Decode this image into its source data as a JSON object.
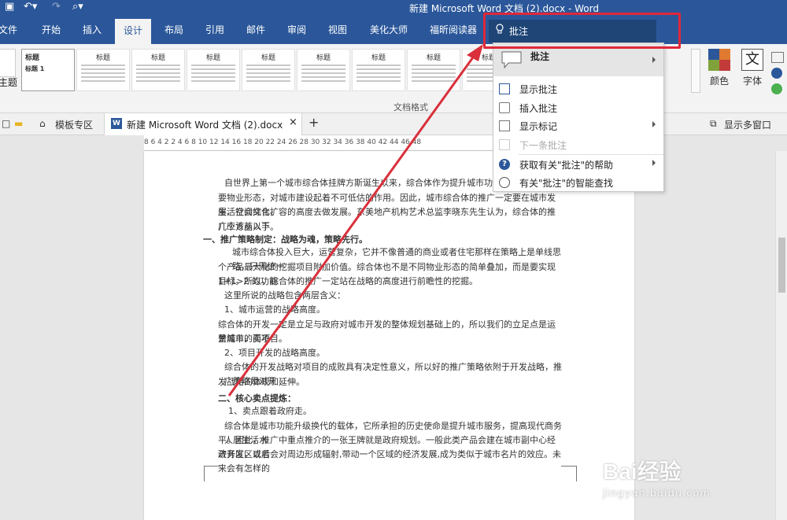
{
  "titlebar": {
    "document_title": "新建 Microsoft Word 文档 (2).docx  -  Word"
  },
  "tabs": [
    {
      "label": "文件"
    },
    {
      "label": "开始"
    },
    {
      "label": "插入"
    },
    {
      "label": "设计",
      "active": true
    },
    {
      "label": "布局"
    },
    {
      "label": "引用"
    },
    {
      "label": "邮件"
    },
    {
      "label": "审阅"
    },
    {
      "label": "视图"
    },
    {
      "label": "美化大师"
    },
    {
      "label": "福昕阅读器"
    }
  ],
  "tell_me": {
    "value": "批注",
    "icon": "lightbulb-icon"
  },
  "ribbon": {
    "left_label": "主题",
    "style_thumbs": [
      {
        "heading": "标题"
      },
      {
        "heading": "标题"
      },
      {
        "heading": "标题"
      },
      {
        "heading": "标题"
      },
      {
        "heading": "标题"
      },
      {
        "heading": "标题"
      },
      {
        "heading": "标题"
      },
      {
        "heading": "标题"
      },
      {
        "heading": "标题"
      }
    ],
    "first_thumb_subtitle": "标题 1",
    "group_label": "文档格式",
    "colors_label": "颜色",
    "fonts_label": "字体"
  },
  "doc_tabs": {
    "template_zone": "模板专区",
    "active_doc": "新建 Microsoft Word 文档 (2).docx",
    "show_multi_window": "显示多窗口"
  },
  "ruler": {
    "ticks": "8   6   4   2       2   4   6   8   10  12  14  16  18  20  22  24  26  28  30  32  34  36  38  40  42  44  46  48"
  },
  "menu": {
    "header": "批注",
    "items": [
      {
        "label": "显示批注",
        "icon": "show-comments-icon",
        "submenu": false,
        "disabled": false
      },
      {
        "label": "插入批注",
        "icon": "insert-comment-icon",
        "submenu": false,
        "disabled": false
      },
      {
        "label": "显示标记",
        "icon": "show-markup-icon",
        "submenu": true,
        "disabled": false
      },
      {
        "label": "下一条批注",
        "icon": "next-comment-icon",
        "submenu": false,
        "disabled": true
      },
      {
        "label": "获取有关\"批注\"的帮助",
        "icon": "help-icon",
        "submenu": true,
        "disabled": false
      },
      {
        "label": "有关\"批注\"的智能查找",
        "icon": "smart-lookup-icon",
        "submenu": false,
        "disabled": false
      }
    ]
  },
  "document": {
    "lines": [
      "自世界上第一个城市综合体挂牌方斯诞生以来，综合体作为提升城市功能、优化城市",
      "要物业形态，对城市建设起着不可低估的作用。因此，城市综合体的推广一定要在城市发展、社会文化、",
      "生活空间综合扩容的高度去做发展。东美地产机构艺术总监李晓东先生认为，综合体的推广应该从以下",
      "几个方面入手。",
      "一、推广策略制定：战略为魂，策略先行。",
      "城市综合体投入巨大，运营复杂，它并不像普通的商业或者住宅那样在策略上是单线思路，只需统一",
      "个产品最大化的挖掘项目附加价值。综合体也不是不同物业形态的简单叠加，而是要实现 1+1>2 的功能",
      "目标。所以，综合体的推广一定站在战略的高度进行前瞻性的挖掘。",
      "这里所说的战略包含两层含义：",
      "1、城市运营的战略高度。",
      "综合体的开发一定是立足与政府对城市开发的整体规划基础上的，所以我们的立足点是运营城市，而不",
      "是简单的卖项目。",
      "2、项目开发的战略高度。",
      "综合体的开发战略对项目的成败具有决定性意义，所以好的推广策略依附于开发战略，推广策略是对开",
      "发战略的体现和延伸。",
      "二、核心卖点提炼：",
      "1、卖点跟着政府走。",
      "综合体是城市功能升级换代的载体，它所承担的历史使命是提升城市服务，提高现代商务人居生活水",
      "平。因此，推广中重点推介的一张王牌就是政府规划。一般此类产品会建在城市副中心经济开发区或者",
      "政务区，以后会对周边形成辐射,带动一个区域的经济发展,成为类似于城市名片的效应。未来会有怎样的"
    ]
  },
  "watermark": {
    "brand": "Bai经验",
    "url": "jingyan.baidu.com"
  },
  "colors": {
    "ribbon_blue": "#2b579a",
    "highlight_red": "#e0283a",
    "arrow_red": "#d9303b"
  }
}
